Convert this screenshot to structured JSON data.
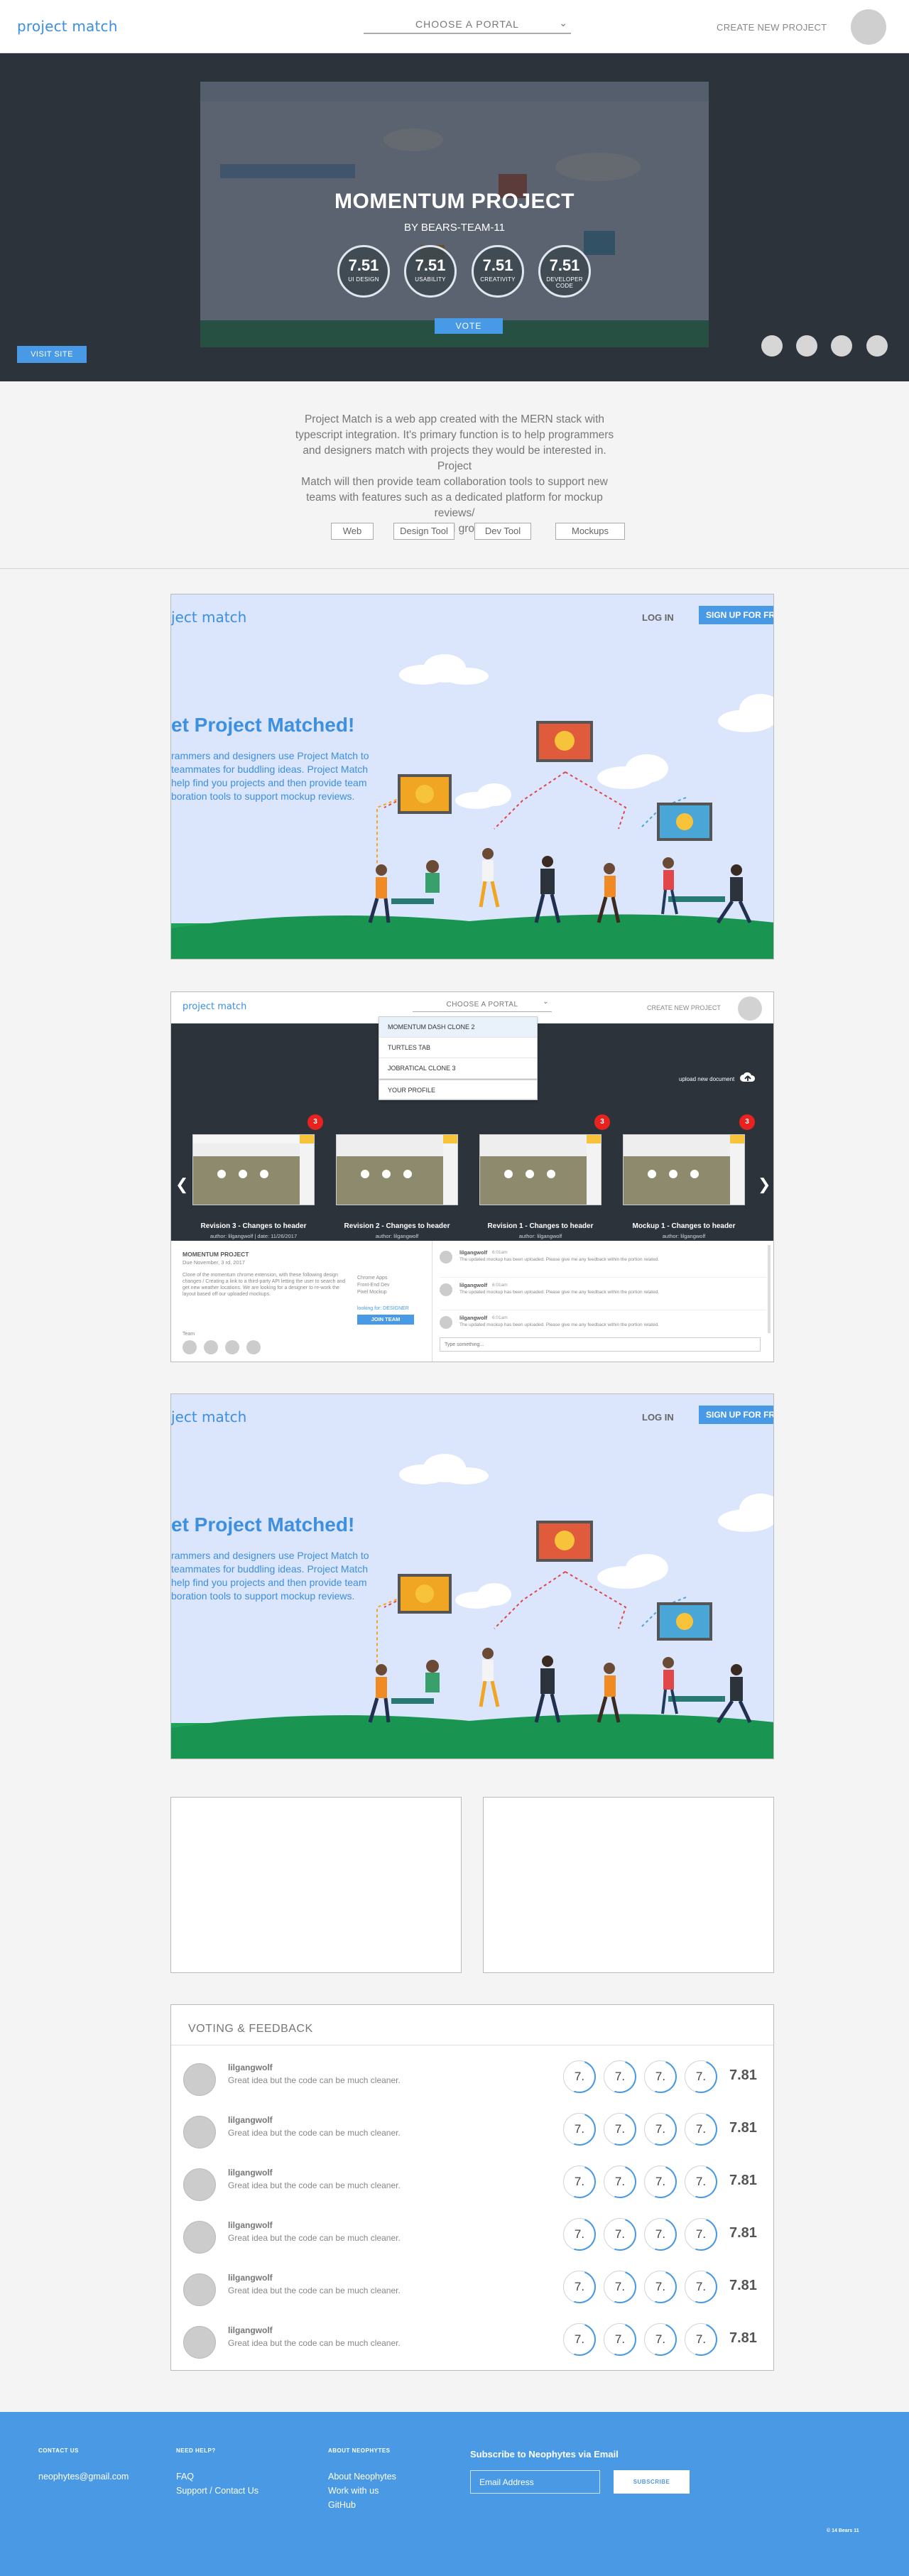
{
  "header": {
    "logo": "project match",
    "portal_label": "CHOOSE A PORTAL",
    "create_label": "CREATE NEW PROJECT"
  },
  "hero": {
    "title": "MOMENTUM PROJECT",
    "subtitle": "BY BEARS-TEAM-11",
    "scores": [
      {
        "value": "7.51",
        "label": "UI DESIGN"
      },
      {
        "value": "7.51",
        "label": "USABILITY"
      },
      {
        "value": "7.51",
        "label": "CREATIVITY"
      },
      {
        "value": "7.51",
        "label": "DEVELOPER CODE"
      }
    ],
    "vote_label": "VOTE",
    "visit_label": "VISIT SITE",
    "slide_count": 4
  },
  "description": {
    "lines": [
      "Project Match is a web app created with the MERN stack with",
      "typescript integration. It's primary function is to help programmers",
      "and designers match with projects they would be interested in. Project",
      "Match will then provide team collaboration tools to support new",
      "teams with features such as a dedicated platform for mockup reviews/",
      "redlines and group chat."
    ],
    "tags": [
      "Web",
      "Design Tool",
      "Dev Tool",
      "Mockups"
    ]
  },
  "landing": {
    "logo": "ject match",
    "login": "LOG IN",
    "signup": "SIGN UP FOR FR",
    "heading": "et Project Matched!",
    "body_lines": [
      "rammers and designers use Project Match to",
      "teammates for buddling ideas. Project Match",
      "help find you projects and then provide team",
      "boration tools to support mockup reviews."
    ]
  },
  "app": {
    "logo": "project match",
    "portal_label": "CHOOSE A PORTAL",
    "create_label": "CREATE NEW PROJECT",
    "dropdown": [
      "MOMENTUM DASH CLONE 2",
      "TURTLES TAB",
      "JOBRATICAL CLONE 3",
      "YOUR PROFILE"
    ],
    "upload_label": "upload new document",
    "revisions": [
      {
        "badge": "3",
        "title": "Revision 3 - Changes to header",
        "meta": "author: lilgangwolf   |   date: 11/26/2017"
      },
      {
        "badge": "",
        "title": "Revision 2 - Changes to header",
        "meta": "author: lilgangwolf"
      },
      {
        "badge": "3",
        "title": "Revision 1 - Changes to header",
        "meta": "author: lilgangwolf"
      },
      {
        "badge": "3",
        "title": "Mockup 1 - Changes to header",
        "meta": "author: lilgangwolf"
      }
    ],
    "project": {
      "title": "MOMENTUM PROJECT",
      "date": "Due November, 3 rd, 2017",
      "summary": "Clone of the momentum chrome extension, with these following design changes / Creating a link to a third-party API letting the user to search and get new weather locations. We are looking for a designer to re-work the layout based off our uploaded mockups.",
      "tech": [
        "Chrome Apps",
        "Front-End Dev",
        "Pixel Mockup"
      ],
      "looking_label": "looking for: DESIGNER",
      "join_label": "JOIN TEAM",
      "team_label": "Team"
    },
    "chat": [
      {
        "name": "lilgangwolf",
        "time": "6:01am",
        "text": "The updated mockup has been uploaded. Please give me any feedback within the portion related."
      },
      {
        "name": "lilgangwolf",
        "time": "6:01am",
        "text": "The updated mockup has been uploaded. Please give me any feedback within the portion related."
      },
      {
        "name": "lilgangwolf",
        "time": "6:01am",
        "text": "The updated mockup has been uploaded. Please give me any feedback within the portion related."
      }
    ],
    "chat_placeholder": "Type something..."
  },
  "voting": {
    "title": "VOTING & FEEDBACK",
    "rows": [
      {
        "name": "lilgangwolf",
        "comment": "Great idea but the code can be much cleaner.",
        "scores": [
          "7.",
          "7.",
          "7.",
          "7."
        ],
        "total": "7.81"
      },
      {
        "name": "lilgangwolf",
        "comment": "Great idea but the code can be much cleaner.",
        "scores": [
          "7.",
          "7.",
          "7.",
          "7."
        ],
        "total": "7.81"
      },
      {
        "name": "lilgangwolf",
        "comment": "Great idea but the code can be much cleaner.",
        "scores": [
          "7.",
          "7.",
          "7.",
          "7."
        ],
        "total": "7.81"
      },
      {
        "name": "lilgangwolf",
        "comment": "Great idea but the code can be much cleaner.",
        "scores": [
          "7.",
          "7.",
          "7.",
          "7."
        ],
        "total": "7.81"
      },
      {
        "name": "lilgangwolf",
        "comment": "Great idea but the code can be much cleaner.",
        "scores": [
          "7.",
          "7.",
          "7.",
          "7."
        ],
        "total": "7.81"
      },
      {
        "name": "lilgangwolf",
        "comment": "Great idea but the code can be much cleaner.",
        "scores": [
          "7.",
          "7.",
          "7.",
          "7."
        ],
        "total": "7.81"
      }
    ]
  },
  "footer": {
    "contact_heading": "CONTACT US",
    "email": "neophytes@gmail.com",
    "help_heading": "NEED HELP?",
    "help_links": [
      "FAQ",
      "Support / Contact Us"
    ],
    "about_heading": "ABOUT NEOPHYTES",
    "about_links": [
      "About Neophytes",
      "Work with us",
      "GitHub"
    ],
    "subscribe_title": "Subscribe to Neophytes via Email",
    "email_placeholder": "Email Address",
    "subscribe_button": "SUBSCRIBE",
    "copyright": "© 14 Bears 11"
  },
  "colors": {
    "brand_blue": "#4899e6",
    "dark": "#2c333b",
    "badge_red": "#e8231f"
  }
}
